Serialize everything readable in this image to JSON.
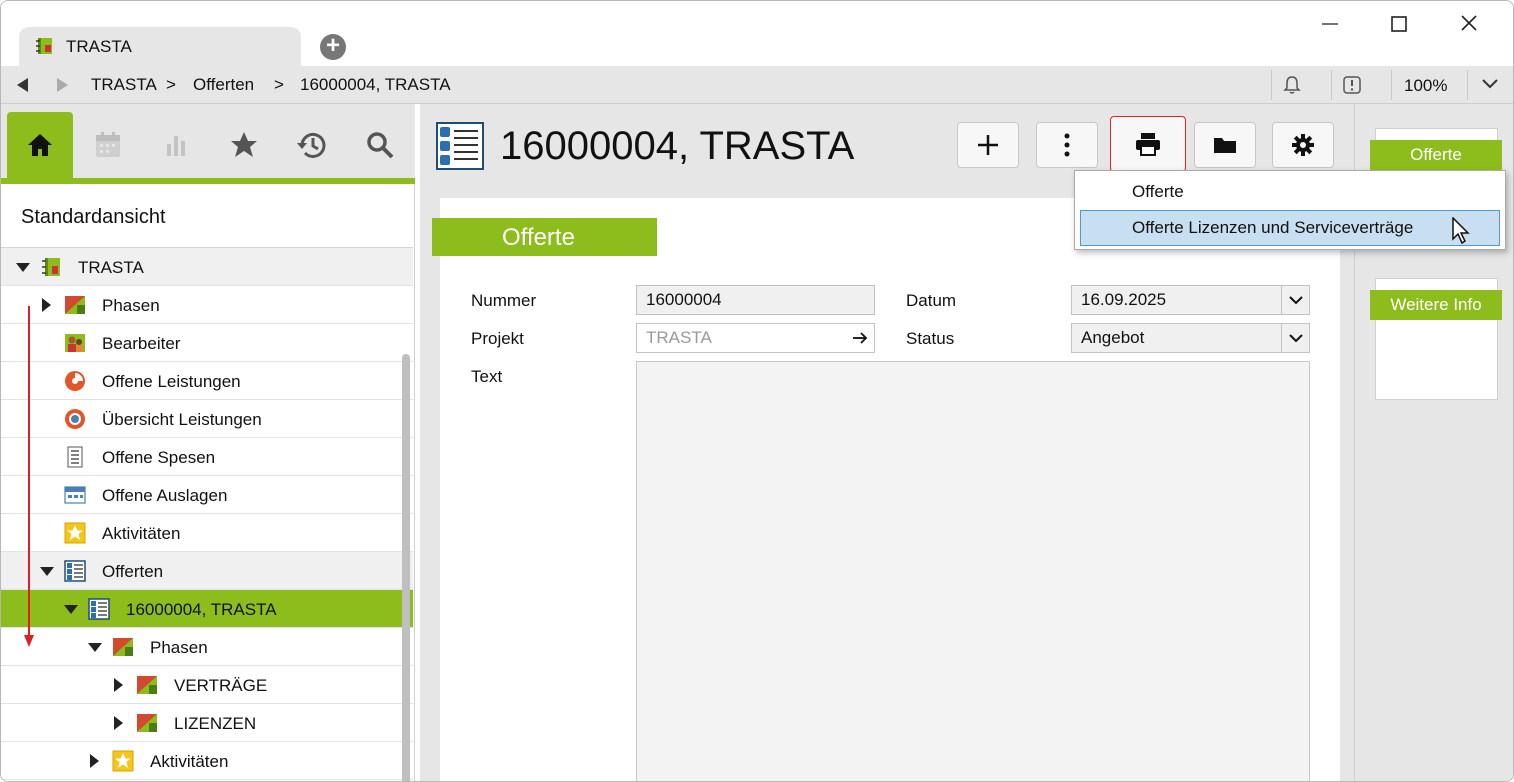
{
  "window": {
    "tab_title": "TRASTA",
    "icons": {
      "new_tab": "plus-circle-icon",
      "minimize": "minimize-icon",
      "maximize": "maximize-icon",
      "close": "close-icon"
    }
  },
  "navbar": {
    "breadcrumb": [
      "TRASTA",
      ">",
      "Offerten",
      ">",
      "16000004, TRASTA"
    ],
    "zoom": "100%",
    "icons": [
      "back-icon",
      "forward-icon",
      "bell-icon",
      "alert-icon",
      "chevron-down-icon"
    ]
  },
  "sidebar": {
    "nav_icons": [
      "home-icon",
      "calendar-icon",
      "chart-icon",
      "star-icon",
      "history-icon",
      "search-icon"
    ],
    "active_nav": "home-icon",
    "view_name": "Standardansicht",
    "tree": [
      {
        "label": "TRASTA",
        "level": 0,
        "toggle": "down",
        "icon": "project-icon",
        "state": "group"
      },
      {
        "label": "Phasen",
        "level": 1,
        "toggle": "right",
        "icon": "phases-icon",
        "state": ""
      },
      {
        "label": "Bearbeiter",
        "level": 1,
        "toggle": "",
        "icon": "users-icon",
        "state": ""
      },
      {
        "label": "Offene Leistungen",
        "level": 1,
        "toggle": "",
        "icon": "open-services-icon",
        "state": ""
      },
      {
        "label": "Übersicht Leistungen",
        "level": 1,
        "toggle": "",
        "icon": "services-overview-icon",
        "state": ""
      },
      {
        "label": "Offene Spesen",
        "level": 1,
        "toggle": "",
        "icon": "expenses-icon",
        "state": ""
      },
      {
        "label": "Offene Auslagen",
        "level": 1,
        "toggle": "",
        "icon": "outlays-icon",
        "state": ""
      },
      {
        "label": "Aktivitäten",
        "level": 1,
        "toggle": "",
        "icon": "activities-icon",
        "state": ""
      },
      {
        "label": "Offerten",
        "level": 1,
        "toggle": "down",
        "icon": "quote-icon",
        "state": "group"
      },
      {
        "label": "16000004, TRASTA",
        "level": 2,
        "toggle": "down",
        "icon": "quote-icon",
        "state": "selected"
      },
      {
        "label": "Phasen",
        "level": 3,
        "toggle": "down",
        "icon": "phases-icon",
        "state": ""
      },
      {
        "label": "VERTRÄGE",
        "level": 4,
        "toggle": "right",
        "icon": "phases-icon",
        "state": ""
      },
      {
        "label": "LIZENZEN",
        "level": 4,
        "toggle": "right",
        "icon": "phases-icon",
        "state": ""
      },
      {
        "label": "Aktivitäten",
        "level": 3,
        "toggle": "right",
        "icon": "activities-icon",
        "state": ""
      }
    ]
  },
  "main": {
    "title": "16000004, TRASTA",
    "toolbar": [
      "add-icon",
      "more-vertical-icon",
      "print-icon",
      "folder-icon",
      "gear-icon"
    ],
    "section": "Offerte",
    "fields": {
      "nummer_label": "Nummer",
      "nummer_value": "16000004",
      "projekt_label": "Projekt",
      "projekt_value": "TRASTA",
      "text_label": "Text",
      "datum_label": "Datum",
      "datum_value": "16.09.2025",
      "status_label": "Status",
      "status_value": "Angebot"
    }
  },
  "print_menu": {
    "items": [
      "Offerte",
      "Offerte Lizenzen und Serviceverträge"
    ],
    "hovered_index": 1
  },
  "right_panel": {
    "tags": [
      "Offerte",
      "Weitere Info"
    ]
  },
  "colors": {
    "accent": "#8cbd1c",
    "chrome": "#e6e6e6",
    "hover": "#c7dff0",
    "hover_border": "#4e9acb",
    "annotation": "#e02020"
  }
}
